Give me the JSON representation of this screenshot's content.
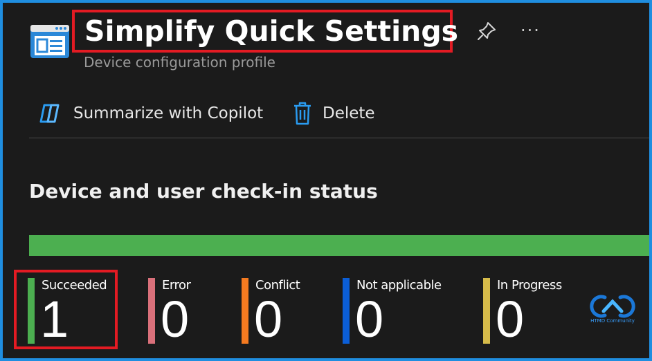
{
  "header": {
    "title": "Simplify Quick Settings",
    "subtitle": "Device configuration profile",
    "more_label": "···"
  },
  "toolbar": {
    "copilot_label": "Summarize with Copilot",
    "delete_label": "Delete"
  },
  "checkin": {
    "section_title": "Device and user check-in status",
    "stats": [
      {
        "label": "Succeeded",
        "count": "1",
        "color": "#4caf50"
      },
      {
        "label": "Error",
        "count": "0",
        "color": "#d9707a"
      },
      {
        "label": "Conflict",
        "count": "0",
        "color": "#f47a20"
      },
      {
        "label": "Not applicable",
        "count": "0",
        "color": "#0b5ed7"
      },
      {
        "label": "In Progress",
        "count": "0",
        "color": "#d6bb4a"
      }
    ],
    "bar_color": "#4caf50"
  },
  "watermark": {
    "text": "HTMD Community"
  }
}
